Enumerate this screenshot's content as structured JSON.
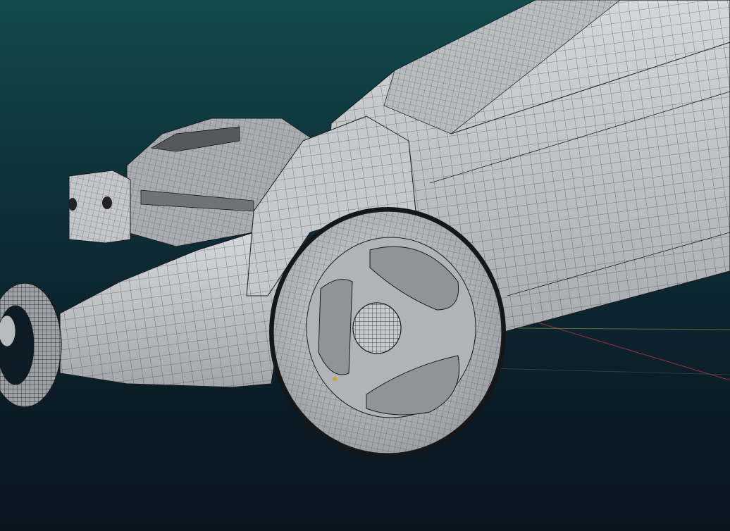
{
  "viewport": {
    "mode": "3d-wireframe-overlay",
    "object": "lawn-mower",
    "colors": {
      "background_top": "#134a4c",
      "background_bottom": "#0a1520",
      "mesh_fill": "#c9cccf",
      "mesh_shadow": "#8d9296",
      "wire": "#1a1c1e",
      "axis_x": "#c0324e",
      "axis_y": "#7a8a3a"
    },
    "icons": [
      "viewport-3d",
      "mesh-object"
    ]
  }
}
